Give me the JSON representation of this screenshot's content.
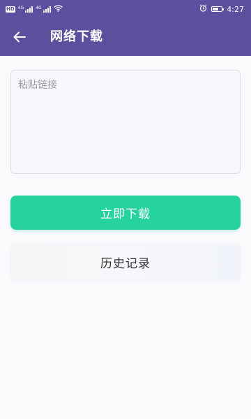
{
  "status_bar": {
    "network_badge": "HD",
    "signal_1_label": "4G",
    "signal_2_label": "4G",
    "alarm_icon": "alarm-icon",
    "wifi_icon": "wifi-icon",
    "battery_level": 0.7,
    "time": "4:27"
  },
  "app_bar": {
    "back_icon": "arrow-left-icon",
    "title": "网络下载"
  },
  "link_input": {
    "value": "",
    "placeholder": "粘贴链接"
  },
  "download_button": {
    "label": "立即下载"
  },
  "history_button": {
    "label": "历史记录"
  },
  "colors": {
    "primary": "#5c4f9e",
    "accent": "#27d39d",
    "background": "#fafafd"
  }
}
